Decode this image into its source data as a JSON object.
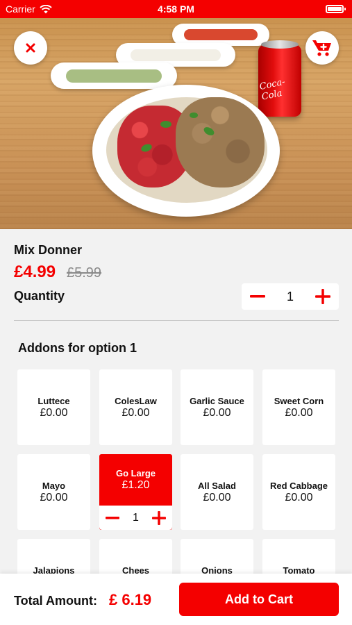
{
  "status_bar": {
    "carrier": "Carrier",
    "time": "4:58 PM"
  },
  "hero": {
    "can_text": "Coca-Cola",
    "icons": {
      "close": "close-icon",
      "cart": "add-to-cart-icon"
    }
  },
  "product": {
    "title": "Mix Donner",
    "price": "£4.99",
    "old_price": "£5.99",
    "quantity_label": "Quantity",
    "quantity": "1"
  },
  "addons": {
    "title": "Addons for option 1",
    "items": [
      {
        "name": "Luttece",
        "price": "£0.00"
      },
      {
        "name": "ColesLaw",
        "price": "£0.00"
      },
      {
        "name": "Garlic Sauce",
        "price": "£0.00"
      },
      {
        "name": "Sweet Corn",
        "price": "£0.00"
      },
      {
        "name": "Mayo",
        "price": "£0.00"
      },
      {
        "name": "Go Large",
        "price": "£1.20",
        "selected": true,
        "quantity": "1"
      },
      {
        "name": "All Salad",
        "price": "£0.00"
      },
      {
        "name": "Red Cabbage",
        "price": "£0.00"
      },
      {
        "name": "Jalapions"
      },
      {
        "name": "Chees"
      },
      {
        "name": "Onions"
      },
      {
        "name": "Tomato"
      }
    ]
  },
  "footer": {
    "total_label": "Total Amount:",
    "total_value": "£ 6.19",
    "add_button": "Add to Cart"
  },
  "colors": {
    "accent": "#f40000",
    "background": "#f2f2f2"
  }
}
